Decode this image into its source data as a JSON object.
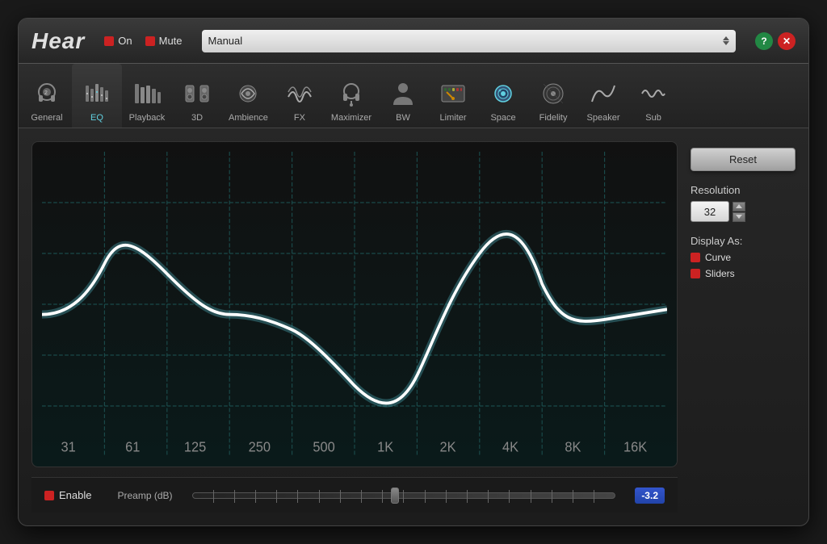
{
  "app": {
    "title": "Hear",
    "header": {
      "on_label": "On",
      "mute_label": "Mute",
      "preset_value": "Manual",
      "help_label": "?",
      "close_label": "✕"
    },
    "tabs": [
      {
        "id": "general",
        "label": "General",
        "active": false,
        "icon": "headphones"
      },
      {
        "id": "eq",
        "label": "EQ",
        "active": true,
        "icon": "eq"
      },
      {
        "id": "playback",
        "label": "Playback",
        "active": false,
        "icon": "bars"
      },
      {
        "id": "3d",
        "label": "3D",
        "active": false,
        "icon": "speakers"
      },
      {
        "id": "ambience",
        "label": "Ambience",
        "active": false,
        "icon": "notes"
      },
      {
        "id": "fx",
        "label": "FX",
        "active": false,
        "icon": "waves"
      },
      {
        "id": "maximizer",
        "label": "Maximizer",
        "active": false,
        "icon": "headset"
      },
      {
        "id": "bw",
        "label": "BW",
        "active": false,
        "icon": "person"
      },
      {
        "id": "limiter",
        "label": "Limiter",
        "active": false,
        "icon": "meter"
      },
      {
        "id": "space",
        "label": "Space",
        "active": false,
        "icon": "robot"
      },
      {
        "id": "fidelity",
        "label": "Fidelity",
        "active": false,
        "icon": "vinyl"
      },
      {
        "id": "speaker",
        "label": "Speaker",
        "active": false,
        "icon": "curve"
      },
      {
        "id": "sub",
        "label": "Sub",
        "active": false,
        "icon": "sub"
      }
    ],
    "eq": {
      "freq_labels": [
        "31",
        "61",
        "125",
        "250",
        "500",
        "1K",
        "2K",
        "4K",
        "8K",
        "16K"
      ],
      "reset_label": "Reset",
      "resolution_label": "Resolution",
      "resolution_value": "32",
      "display_as_label": "Display As:",
      "curve_label": "Curve",
      "sliders_label": "Sliders",
      "enable_label": "Enable",
      "preamp_label": "Preamp (dB)",
      "preamp_value": "-3.2"
    }
  }
}
